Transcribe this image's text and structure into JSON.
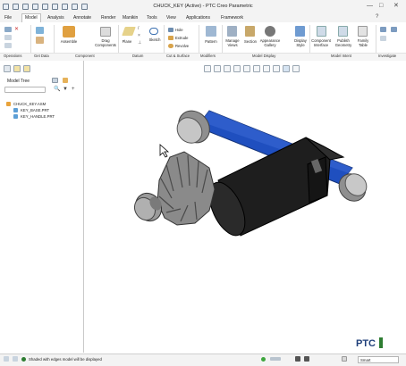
{
  "window": {
    "title": "CHUCK_KEY (Active) - PTC Creo Parametric",
    "controls": [
      "minimize-icon",
      "maximize-icon",
      "close-icon"
    ]
  },
  "tabs": [
    {
      "label": "File",
      "active": false
    },
    {
      "label": "Model",
      "active": true
    },
    {
      "label": "Analysis",
      "active": false
    },
    {
      "label": "Annotate",
      "active": false
    },
    {
      "label": "Render",
      "active": false
    },
    {
      "label": "Manikin",
      "active": false
    },
    {
      "label": "Tools",
      "active": false
    },
    {
      "label": "View",
      "active": false
    },
    {
      "label": "Applications",
      "active": false
    },
    {
      "label": "Framework",
      "active": false
    }
  ],
  "ribbon": {
    "assemble": "Assemble",
    "drag_components": "Drag Components",
    "plane": "Plane",
    "sketch": "Sketch",
    "hole": "Hole",
    "extrude": "Extrude",
    "revolve": "Revolve",
    "pattern": "Pattern",
    "manage_views": "Manage Views",
    "section": "Section",
    "appearance_gallery": "Appearance Gallery",
    "display_style": "Display Style",
    "component_interface": "Component Interface",
    "publish_geometry": "Publish Geometry",
    "family_table": "Family Table",
    "groups": [
      "Operations",
      "Get Data",
      "Component",
      "Datum",
      "Cut & Surface",
      "Modifiers",
      "Model Display",
      "Model Intent",
      "Investigate"
    ]
  },
  "model_tree": {
    "title": "Model Tree",
    "items": [
      {
        "label": "CHUCK_KEY.ASM",
        "type": "asm"
      },
      {
        "label": "KEY_BASE.PRT",
        "type": "prt"
      },
      {
        "label": "KEY_HANDLE.PRT",
        "type": "prt"
      }
    ]
  },
  "viewport": {
    "brand": "PTC",
    "model_colors": {
      "gear": "#8a8a8a",
      "body": "#1e1e1e",
      "handle": "#1f4fbf",
      "endcap": "#b8b8b8"
    }
  },
  "statusbar": {
    "message": "Shaded with edges model will be displayed",
    "filter": "Smart"
  }
}
